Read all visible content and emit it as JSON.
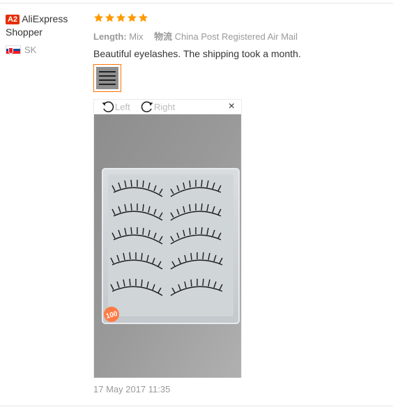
{
  "user": {
    "badge": "A2",
    "name": "AliExpress Shopper",
    "country_code": "SK"
  },
  "review": {
    "rating": 5,
    "rating_max": 5,
    "length_label": "Length:",
    "length_value": "Mix",
    "shipping_label": "物流",
    "shipping_value": "China Post Registered Air Mail",
    "text": "Beautiful eyelashes. The shipping took a month.",
    "date": "17 May 2017 11:35"
  },
  "viewer": {
    "rotate_left_label": "Left",
    "rotate_right_label": "Right",
    "close_symbol": "×",
    "sticker_text": "100"
  },
  "colors": {
    "star": "#ff9a00",
    "badge": "#e62e04",
    "thumb_border": "#ff7300",
    "muted_text": "#999999"
  }
}
